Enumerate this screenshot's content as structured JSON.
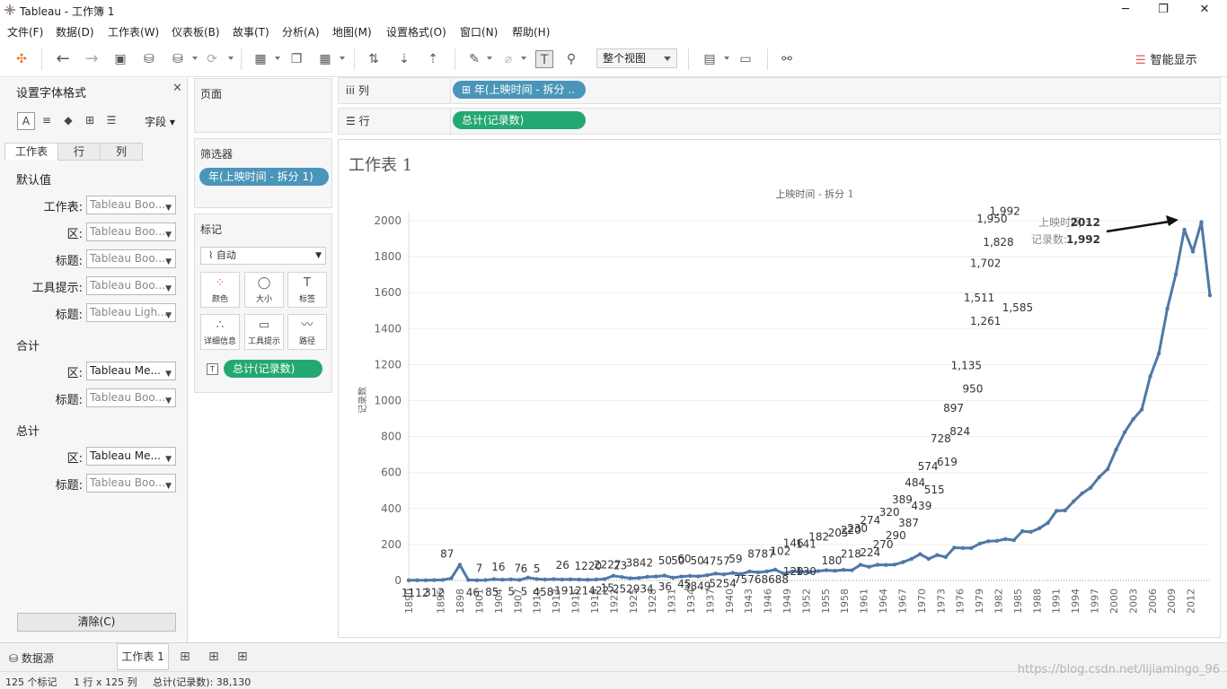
{
  "window": {
    "title": "Tableau - 工作簿 1",
    "minimize": "─",
    "restore": "❐",
    "close": "✕"
  },
  "menu": [
    "文件(F)",
    "数据(D)",
    "工作表(W)",
    "仪表板(B)",
    "故事(T)",
    "分析(A)",
    "地图(M)",
    "设置格式(O)",
    "窗口(N)",
    "帮助(H)"
  ],
  "toolbar": {
    "fit_label": "整个视图",
    "show_me_label": "智能显示"
  },
  "format_pane": {
    "title": "设置字体格式",
    "field_dropdown": "字段",
    "tabs": [
      "工作表",
      "行",
      "列"
    ],
    "section_default": "默认值",
    "section_totals": "合计",
    "section_grand": "总计",
    "rows_default": [
      {
        "label": "工作表:",
        "value": "Tableau Boo..."
      },
      {
        "label": "区:",
        "value": "Tableau Boo..."
      },
      {
        "label": "标题:",
        "value": "Tableau Boo..."
      },
      {
        "label": "工具提示:",
        "value": "Tableau Boo..."
      },
      {
        "label": "标题:",
        "value": "Tableau Ligh..."
      }
    ],
    "rows_totals": [
      {
        "label": "区:",
        "value": "Tableau Me..."
      },
      {
        "label": "标题:",
        "value": "Tableau Boo..."
      }
    ],
    "rows_grand": [
      {
        "label": "区:",
        "value": "Tableau Me..."
      },
      {
        "label": "标题:",
        "value": "Tableau Boo..."
      }
    ],
    "clear_label": "清除(C)"
  },
  "cards": {
    "pages_title": "页面",
    "filters_title": "筛选器",
    "filter_pill": "年(上映时间 - 拆分 1)",
    "marks_title": "标记",
    "mark_type": "自动",
    "mark_buttons": [
      "颜色",
      "大小",
      "标签",
      "详细信息",
      "工具提示",
      "路径"
    ],
    "marks_pill": "总计(记录数)"
  },
  "shelves": {
    "columns_label": "列",
    "columns_pill": "年(上映时间 - 拆分 ..",
    "rows_label": "行",
    "rows_pill": "总计(记录数)"
  },
  "sheet": {
    "title": "工作表 1"
  },
  "chart_data": {
    "type": "line",
    "title": "上映时间 - 拆分 1",
    "xlabel": "",
    "ylabel": "记录数",
    "ylim": [
      0,
      2000
    ],
    "yticks": [
      0,
      200,
      400,
      600,
      800,
      1000,
      1200,
      1400,
      1600,
      1800,
      2000
    ],
    "x": [
      1890,
      1891,
      1892,
      1893,
      1894,
      1895,
      1896,
      1897,
      1898,
      1899,
      1900,
      1901,
      1902,
      1903,
      1904,
      1905,
      1906,
      1907,
      1908,
      1909,
      1910,
      1911,
      1912,
      1913,
      1914,
      1915,
      1916,
      1917,
      1918,
      1919,
      1920,
      1921,
      1922,
      1923,
      1924,
      1925,
      1926,
      1927,
      1928,
      1929,
      1930,
      1931,
      1932,
      1933,
      1934,
      1935,
      1936,
      1937,
      1938,
      1939,
      1940,
      1941,
      1942,
      1943,
      1944,
      1945,
      1946,
      1947,
      1948,
      1949,
      1950,
      1951,
      1952,
      1953,
      1954,
      1955,
      1956,
      1957,
      1958,
      1959,
      1960,
      1961,
      1962,
      1963,
      1964,
      1965,
      1966,
      1967,
      1968,
      1969,
      1970,
      1971,
      1972,
      1973,
      1974,
      1975,
      1976,
      1977,
      1978,
      1979,
      1980,
      1981,
      1982,
      1983,
      1984,
      1985,
      1986,
      1987,
      1988,
      1989,
      1990,
      1991,
      1992,
      1993,
      1994,
      1995,
      1996,
      1997,
      1998,
      1999,
      2000,
      2001,
      2002,
      2003,
      2004,
      2005,
      2006,
      2007,
      2008,
      2009,
      2010,
      2011,
      2012,
      2013,
      2014,
      2015
    ],
    "values": [
      1,
      1,
      1,
      2,
      3,
      12,
      87,
      3,
      1,
      2,
      7,
      4,
      6,
      3,
      16,
      8,
      5,
      7,
      5,
      6,
      5,
      4,
      5,
      8,
      26,
      19,
      12,
      14,
      20,
      22,
      27,
      15,
      22,
      25,
      23,
      29,
      38,
      34,
      42,
      36,
      50,
      45,
      50,
      60,
      38,
      50,
      49,
      47,
      52,
      57,
      54,
      59,
      57,
      87,
      76,
      87,
      86,
      88,
      102,
      120,
      146,
      120,
      141,
      130,
      182,
      180,
      180,
      205,
      218,
      220,
      230,
      224,
      274,
      270,
      290,
      320,
      387,
      389,
      439,
      484,
      515,
      574,
      619,
      728,
      824,
      897,
      950,
      1135,
      1261,
      1511,
      1702,
      1950,
      1828,
      1992,
      1585
    ],
    "x_display_note": "",
    "tick_labels": [
      "1890",
      "1895",
      "1898",
      "1901",
      "1904",
      "1907",
      "1910",
      "1913",
      "1916",
      "1919",
      "1922",
      "1925",
      "1928",
      "1931",
      "1934",
      "1937",
      "1940",
      "1943",
      "1946",
      "1949",
      "1952",
      "1955",
      "1958",
      "1961",
      "1964",
      "1967",
      "1970",
      "1973",
      "1976",
      "1979",
      "1982",
      "1985",
      "1988",
      "1991",
      "1994",
      "1997",
      "2000",
      "2003",
      "2006",
      "2009",
      "2012"
    ],
    "point_labels": [
      {
        "text": "87",
        "x": 1896,
        "y": 87
      },
      {
        "text": "7",
        "x": 1901,
        "y": 7
      },
      {
        "text": "16",
        "x": 1904,
        "y": 16
      },
      {
        "text": "7",
        "x": 1907,
        "y": 7
      },
      {
        "text": "6",
        "x": 1908,
        "y": 6
      },
      {
        "text": "5",
        "x": 1910,
        "y": 5
      },
      {
        "text": "26",
        "x": 1914,
        "y": 26
      },
      {
        "text": "1220",
        "x": 1918,
        "y": 20
      },
      {
        "text": "2227",
        "x": 1921,
        "y": 27
      },
      {
        "text": "23",
        "x": 1923,
        "y": 23
      },
      {
        "text": "3842",
        "x": 1926,
        "y": 38
      },
      {
        "text": "50",
        "x": 1930,
        "y": 50
      },
      {
        "text": "50",
        "x": 1932,
        "y": 50
      },
      {
        "text": "60",
        "x": 1933,
        "y": 60
      },
      {
        "text": "50",
        "x": 1935,
        "y": 50
      },
      {
        "text": "4757",
        "x": 1938,
        "y": 47
      },
      {
        "text": "59",
        "x": 1941,
        "y": 59
      },
      {
        "text": "8787",
        "x": 1945,
        "y": 87
      },
      {
        "text": "102",
        "x": 1948,
        "y": 102
      },
      {
        "text": "146",
        "x": 1950,
        "y": 146
      },
      {
        "text": "141",
        "x": 1952,
        "y": 141
      },
      {
        "text": "182",
        "x": 1954,
        "y": 182
      },
      {
        "text": "205",
        "x": 1957,
        "y": 205
      },
      {
        "text": "220",
        "x": 1959,
        "y": 220
      },
      {
        "text": "230",
        "x": 1960,
        "y": 230
      },
      {
        "text": "274",
        "x": 1962,
        "y": 274
      },
      {
        "text": "320",
        "x": 1965,
        "y": 320
      },
      {
        "text": "389",
        "x": 1967,
        "y": 389
      },
      {
        "text": "484",
        "x": 1969,
        "y": 484
      },
      {
        "text": "574",
        "x": 1971,
        "y": 574
      },
      {
        "text": "728",
        "x": 1973,
        "y": 728
      },
      {
        "text": "897",
        "x": 1975,
        "y": 897
      },
      {
        "text": "1,135",
        "x": 1977,
        "y": 1135
      },
      {
        "text": "1,511",
        "x": 1979,
        "y": 1511
      },
      {
        "text": "1,702",
        "x": 1980,
        "y": 1702
      },
      {
        "text": "1,950",
        "x": 1981,
        "y": 1950
      },
      {
        "text": "1,992",
        "x": 1983,
        "y": 1992
      }
    ],
    "below_labels": [
      {
        "text": "1112",
        "x": 1891
      },
      {
        "text": "312",
        "x": 1894
      },
      {
        "text": "46",
        "x": 1900
      },
      {
        "text": "85",
        "x": 1903
      },
      {
        "text": "5",
        "x": 1906
      },
      {
        "text": "5",
        "x": 1908
      },
      {
        "text": "458",
        "x": 1911
      },
      {
        "text": "19121422",
        "x": 1917
      },
      {
        "text": "15",
        "x": 1921
      },
      {
        "text": "252934",
        "x": 1925
      },
      {
        "text": "36",
        "x": 1930
      },
      {
        "text": "45",
        "x": 1933
      },
      {
        "text": "3849",
        "x": 1935
      },
      {
        "text": "5254",
        "x": 1939
      },
      {
        "text": "75768688",
        "x": 1945
      },
      {
        "text": "120",
        "x": 1950
      },
      {
        "text": "130",
        "x": 1952
      },
      {
        "text": "180",
        "x": 1956
      },
      {
        "text": "218",
        "x": 1959
      },
      {
        "text": "224",
        "x": 1962
      },
      {
        "text": "270",
        "x": 1964
      },
      {
        "text": "290",
        "x": 1966
      },
      {
        "text": "387",
        "x": 1968
      },
      {
        "text": "439",
        "x": 1970
      },
      {
        "text": "515",
        "x": 1972
      },
      {
        "text": "619",
        "x": 1974
      },
      {
        "text": "824",
        "x": 1976
      },
      {
        "text": "950",
        "x": 1978
      },
      {
        "text": "1,261",
        "x": 1980
      },
      {
        "text": "1,828",
        "x": 1982
      },
      {
        "text": "1,585",
        "x": 1985
      }
    ],
    "tooltip": {
      "line1_label": "上映时间 :",
      "line1_value": "2012",
      "line2_label": "记录数:",
      "line2_value": "1,992"
    },
    "line_color": "#4e79a7"
  },
  "bottom_tabs": {
    "datasource": "数据源",
    "sheet": "工作表 1"
  },
  "status": {
    "marks": "125 个标记",
    "dims": "1 行 x 125 列",
    "sum": "总计(记录数): 38,130"
  },
  "watermark": "https://blog.csdn.net/lijiamingo_96"
}
